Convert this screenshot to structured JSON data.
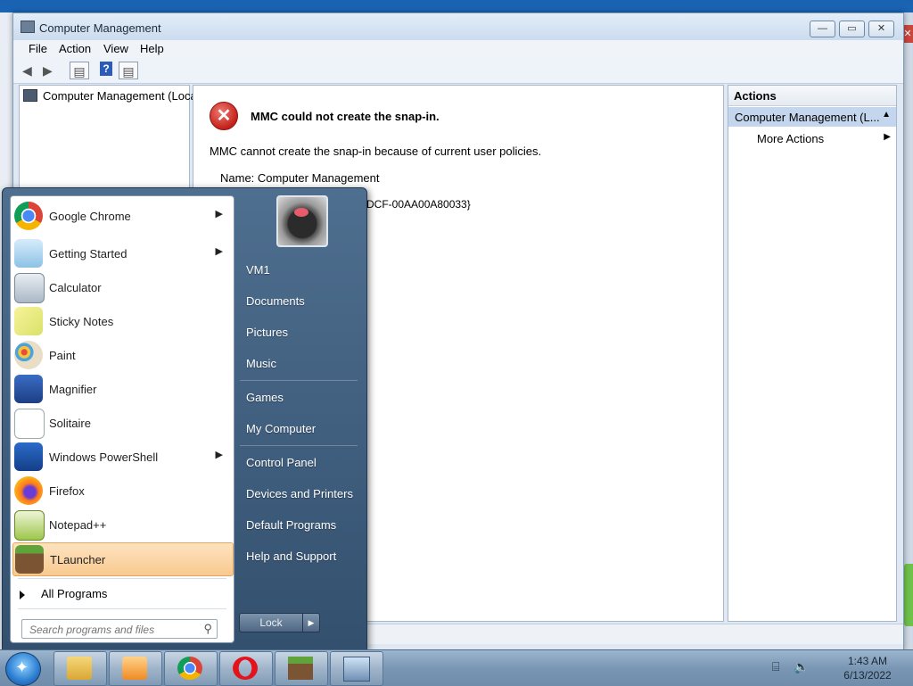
{
  "window": {
    "title": "Computer Management",
    "controls": [
      "minimize-icon",
      "maximize-icon",
      "close-icon"
    ]
  },
  "menu": [
    "File",
    "Action",
    "View",
    "Help"
  ],
  "toolbar": {
    "icons": [
      "back-arrow-icon",
      "forward-arrow-icon",
      "show-hide-tree-icon",
      "help-icon",
      "show-hide-action-pane-icon"
    ]
  },
  "tree": {
    "root": "Computer Management (Local"
  },
  "error": {
    "title": "MMC could not create the snap-in.",
    "message": "MMC cannot create the snap-in because of current user policies.",
    "name": "Name: Computer Management",
    "clsid": "DCF-00AA00A80033}"
  },
  "actions": {
    "header": "Actions",
    "group": "Computer Management (L...",
    "more": "More Actions"
  },
  "start_menu": {
    "programs": [
      {
        "label": "Google Chrome",
        "icon": "chrome-icon",
        "submenu": true
      },
      {
        "label": "Getting Started",
        "icon": "getting-started-icon",
        "submenu": true
      },
      {
        "label": "Calculator",
        "icon": "calculator-icon",
        "submenu": false
      },
      {
        "label": "Sticky Notes",
        "icon": "sticky-notes-icon",
        "submenu": false
      },
      {
        "label": "Paint",
        "icon": "paint-icon",
        "submenu": false
      },
      {
        "label": "Magnifier",
        "icon": "magnifier-icon",
        "submenu": false
      },
      {
        "label": "Solitaire",
        "icon": "solitaire-icon",
        "submenu": false
      },
      {
        "label": "Windows PowerShell",
        "icon": "powershell-icon",
        "submenu": true
      },
      {
        "label": "Firefox",
        "icon": "firefox-icon",
        "submenu": false
      },
      {
        "label": "Notepad++",
        "icon": "notepad-plus-plus-icon",
        "submenu": false
      },
      {
        "label": "TLauncher",
        "icon": "tlauncher-icon",
        "submenu": false,
        "highlighted": true
      }
    ],
    "all_programs": "All Programs",
    "search_placeholder": "Search programs and files",
    "right_items": [
      "VM1",
      "Documents",
      "Pictures",
      "Music",
      "Games",
      "My Computer",
      "Control Panel",
      "Devices and Printers",
      "Default Programs",
      "Help and Support"
    ],
    "lock_label": "Lock"
  },
  "taskbar": {
    "apps": [
      "explorer-icon",
      "media-player-icon",
      "chrome-icon",
      "opera-icon",
      "tlauncher-icon",
      "remote-desktop-icon"
    ],
    "time": "1:43 AM",
    "date": "6/13/2022"
  }
}
